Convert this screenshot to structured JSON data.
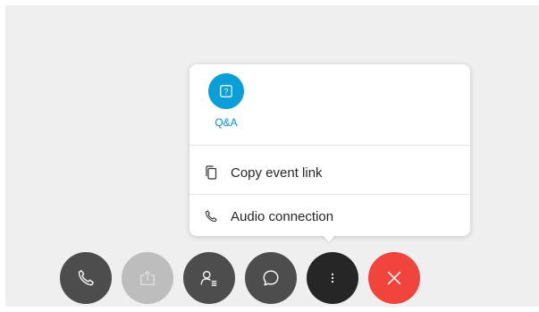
{
  "popup": {
    "qa_icon_glyph": "?",
    "qa_label": "Q&A",
    "menu_items": [
      {
        "label": "Copy event link",
        "icon": "copy-icon"
      },
      {
        "label": "Audio connection",
        "icon": "phone-icon"
      }
    ]
  },
  "controls": [
    {
      "name": "audio-button",
      "icon": "phone-icon",
      "state": "enabled"
    },
    {
      "name": "share-button",
      "icon": "share-icon",
      "state": "disabled"
    },
    {
      "name": "participants-button",
      "icon": "participants-icon",
      "state": "enabled"
    },
    {
      "name": "chat-button",
      "icon": "chat-icon",
      "state": "enabled"
    },
    {
      "name": "more-options-button",
      "icon": "more-vertical-icon",
      "state": "active"
    },
    {
      "name": "leave-button",
      "icon": "close-icon",
      "state": "danger"
    }
  ],
  "colors": {
    "accent": "#0a9fd8",
    "danger": "#f0443d",
    "control_dark": "#4d4d4d",
    "control_disabled": "#bdbdbd",
    "control_active": "#262626"
  }
}
